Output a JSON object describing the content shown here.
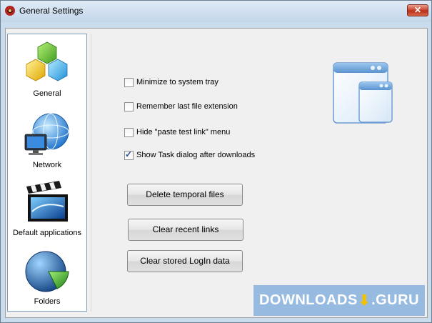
{
  "window": {
    "title": "General Settings",
    "close_glyph": "✕"
  },
  "sidebar": {
    "items": [
      {
        "label": "General",
        "icon": "cubes-icon"
      },
      {
        "label": "Network",
        "icon": "globe-monitor-icon"
      },
      {
        "label": "Default applications",
        "icon": "clapperboard-icon"
      },
      {
        "label": "Folders",
        "icon": "pie-chart-icon"
      }
    ]
  },
  "options": [
    {
      "label": "Minimize to system tray",
      "checked": false
    },
    {
      "label": "Remember last file extension",
      "checked": false
    },
    {
      "label": "Hide \"paste test link\" menu",
      "checked": false
    },
    {
      "label": "Show Task dialog after downloads",
      "checked": true
    }
  ],
  "buttons": {
    "delete_temporal": "Delete temporal files",
    "clear_recent": "Clear recent links",
    "clear_stored": "Clear stored LogIn data"
  },
  "watermark": {
    "left": "DOWNLOADS",
    "right": ".GURU"
  },
  "colors": {
    "accent": "#2a4f8f",
    "titlebar": "#c9dcee",
    "close_button": "#c8422c",
    "watermark": "#82afdc"
  }
}
